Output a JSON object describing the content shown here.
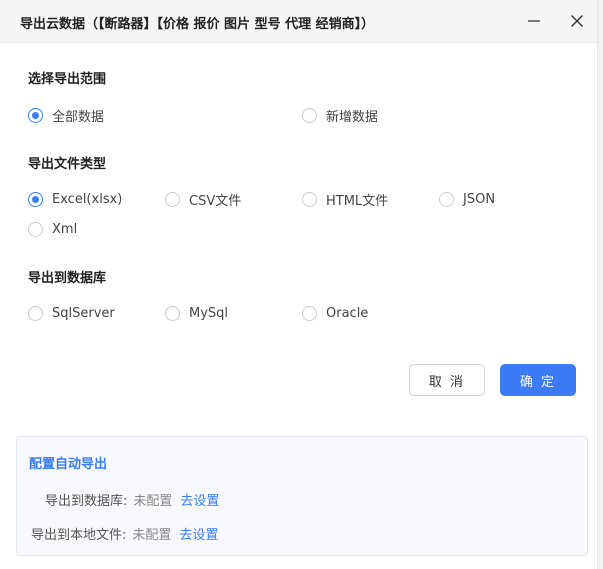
{
  "window": {
    "title": "导出云数据（【断路器】【价格 报价 图片 型号 代理 经销商】）"
  },
  "range": {
    "title": "选择导出范围",
    "options": [
      {
        "label": "全部数据",
        "checked": true
      },
      {
        "label": "新增数据",
        "checked": false
      }
    ]
  },
  "filetype": {
    "title": "导出文件类型",
    "options": [
      {
        "label": "Excel(xlsx)",
        "checked": true
      },
      {
        "label": "CSV文件",
        "checked": false
      },
      {
        "label": "HTML文件",
        "checked": false
      },
      {
        "label": "JSON",
        "checked": false
      },
      {
        "label": "Xml",
        "checked": false
      }
    ]
  },
  "database": {
    "title": "导出到数据库",
    "options": [
      {
        "label": "SqlServer",
        "checked": false
      },
      {
        "label": "MySql",
        "checked": false
      },
      {
        "label": "Oracle",
        "checked": false
      }
    ]
  },
  "buttons": {
    "cancel": "取 消",
    "ok": "确 定"
  },
  "auto_export": {
    "title": "配置自动导出",
    "rows": [
      {
        "label": "导出到数据库:",
        "status": "未配置",
        "link": "去设置"
      },
      {
        "label": "导出到本地文件:",
        "status": "未配置",
        "link": "去设置"
      }
    ]
  },
  "colors": {
    "accent": "#3b7cf6"
  }
}
